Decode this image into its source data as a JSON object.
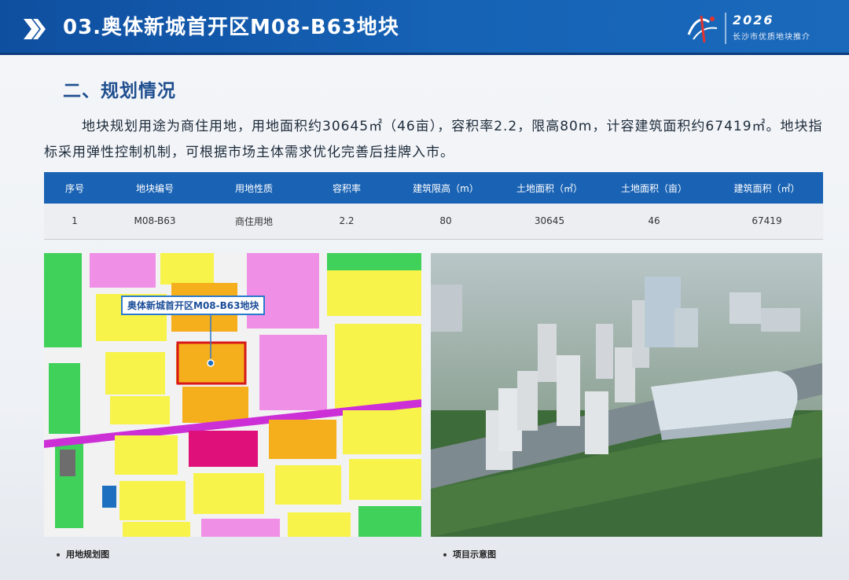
{
  "header": {
    "title": "03.奥体新城首开区M08-B63地块",
    "logo": {
      "year": "2026",
      "subtitle": "长沙市优质地块推介"
    }
  },
  "section": {
    "heading": "二、规划情况",
    "paragraph": "地块规划用途为商住用地，用地面积约30645㎡（46亩），容积率2.2，限高80m，计容建筑面积约67419㎡。地块指标采用弹性控制机制，可根据市场主体需求优化完善后挂牌入市。"
  },
  "table": {
    "headers": [
      "序号",
      "地块编号",
      "用地性质",
      "容积率",
      "建筑限高（m）",
      "土地面积（㎡）",
      "土地面积（亩）",
      "建筑面积（㎡）"
    ],
    "rows": [
      [
        "1",
        "M08-B63",
        "商住用地",
        "2.2",
        "80",
        "30645",
        "46",
        "67419"
      ]
    ]
  },
  "map": {
    "callout": "奥体新城首开区M08-B63地块",
    "caption": "用地规划图"
  },
  "render": {
    "caption": "项目示意图"
  },
  "colors": {
    "header_blue": "#1663b6",
    "heading_blue": "#1f4f8f",
    "table_header": "#1a63b4",
    "land_residential": "#f7f34a",
    "land_commercial_residential": "#f5ae1c",
    "land_green": "#3fd15a",
    "land_public": "#f08fe6",
    "land_commercial": "#e0107a",
    "road_purple": "#cc2fd6"
  }
}
